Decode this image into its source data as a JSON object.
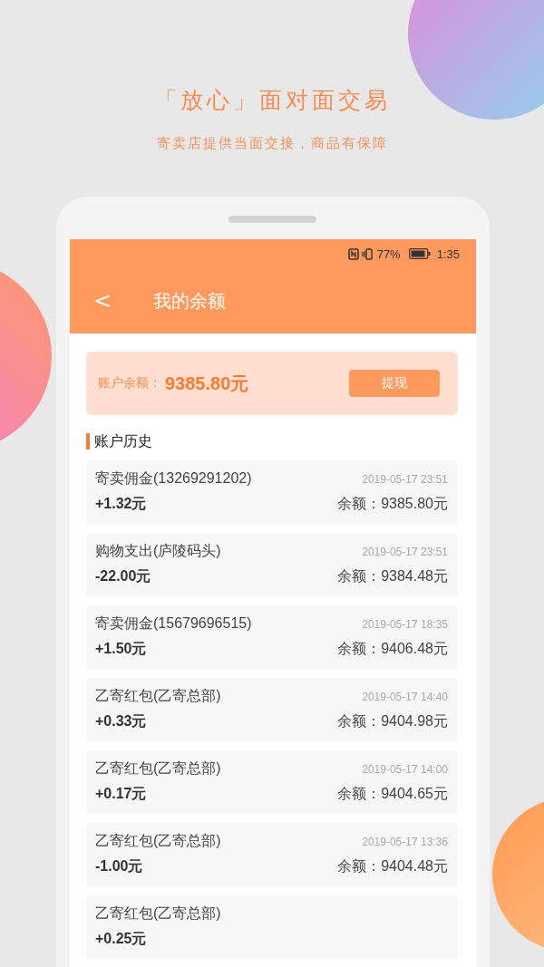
{
  "promo": {
    "headline": "「放心」面对面交易",
    "subheadline": "寄卖店提供当面交接，商品有保障"
  },
  "status_bar": {
    "battery": "77%",
    "time": "1:35"
  },
  "header": {
    "back": "<",
    "title": "我的余额"
  },
  "balance_card": {
    "label": "账户余额：",
    "amount": "9385.80元",
    "button": "提现"
  },
  "history": {
    "title": "账户历史",
    "entries": [
      {
        "description": "寄卖佣金(13269291202)",
        "time": "2019-05-17 23:51",
        "amount": "+1.32元",
        "balance": "余额：9385.80元"
      },
      {
        "description": "购物支出(庐陵码头)",
        "time": "2019-05-17 23:51",
        "amount": "-22.00元",
        "balance": "余额：9384.48元"
      },
      {
        "description": "寄卖佣金(15679696515)",
        "time": "2019-05-17 18:35",
        "amount": "+1.50元",
        "balance": "余额：9406.48元"
      },
      {
        "description": "乙寄红包(乙寄总部)",
        "time": "2019-05-17 14:40",
        "amount": "+0.33元",
        "balance": "余额：9404.98元"
      },
      {
        "description": "乙寄红包(乙寄总部)",
        "time": "2019-05-17 14:00",
        "amount": "+0.17元",
        "balance": "余额：9404.65元"
      },
      {
        "description": "乙寄红包(乙寄总部)",
        "time": "2019-05-17 13:36",
        "amount": "-1.00元",
        "balance": "余额：9404.48元"
      },
      {
        "description": "乙寄红包(乙寄总部)",
        "amount": "+0.25元"
      }
    ]
  }
}
